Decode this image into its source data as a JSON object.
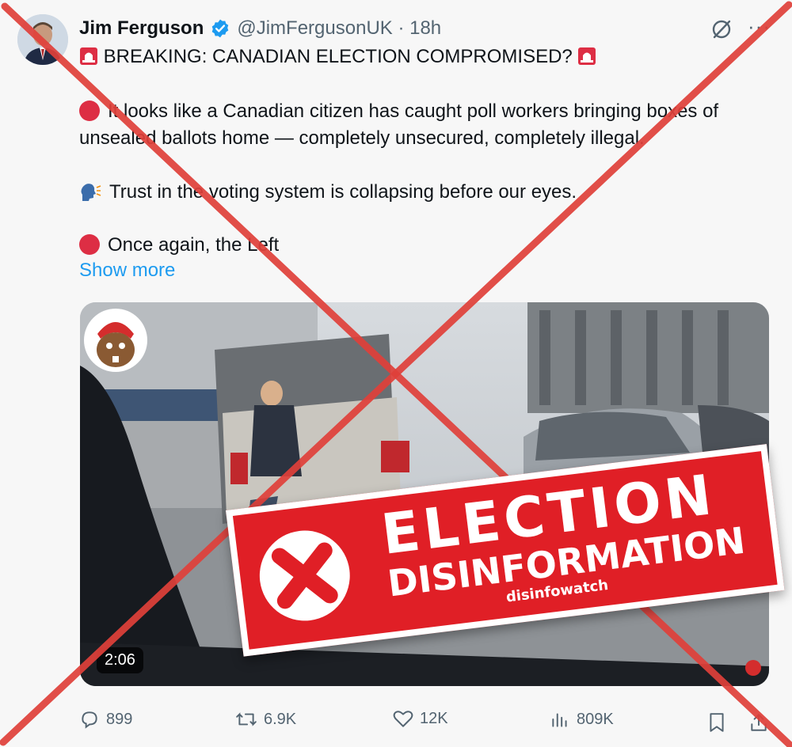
{
  "tweet": {
    "name": "Jim Ferguson",
    "handle": "@JimFergusonUK · 18h",
    "headline": " BREAKING: CANADIAN ELECTION COMPROMISED? ",
    "p1_line1": "It looks like a Canadian citizen has caught poll workers bringing boxes of",
    "p1_line2": "unsealed ballots home — completely unsecured, completely illegal.",
    "p2": "Trust in the voting system is collapsing before our eyes.",
    "p3": "Once again, the Left",
    "show_more": "Show more",
    "video_duration": "2:06"
  },
  "actions": {
    "replies": "899",
    "reposts": "6.9K",
    "likes": "12K",
    "views": "809K"
  },
  "overlay": {
    "line1": "ELECTION",
    "line2": "DISINFORMATION",
    "brand": "disinfowatch"
  },
  "colors": {
    "cross": "#e0403a",
    "banner": "#e01f26",
    "link": "#1d9bf0"
  }
}
